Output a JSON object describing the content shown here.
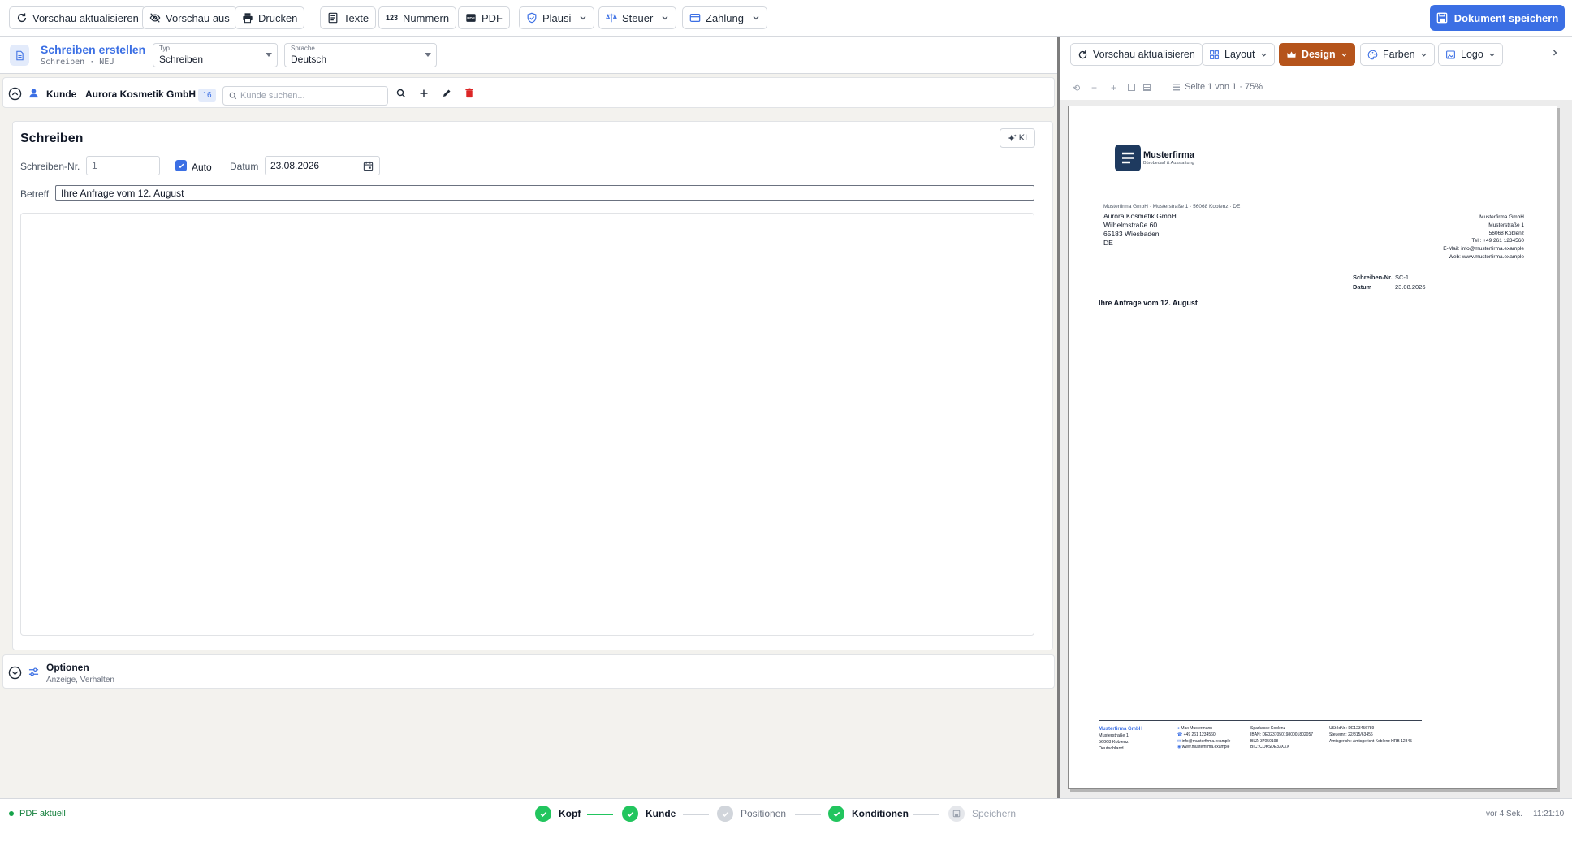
{
  "toolbar": {
    "refresh_preview": "Vorschau aktualisieren",
    "preview_off": "Vorschau aus",
    "print": "Drucken",
    "texts": "Texte",
    "numbers": "Nummern",
    "pdf": "PDF",
    "plausi": "Plausi",
    "tax": "Steuer",
    "payment": "Zahlung",
    "save_document": "Dokument speichern"
  },
  "doc_header": {
    "title": "Schreiben erstellen",
    "subtitle": "Schreiben · NEU",
    "type_label": "Typ",
    "type_value": "Schreiben",
    "language_label": "Sprache",
    "language_value": "Deutsch"
  },
  "customer": {
    "label": "Kunde",
    "name": "Aurora Kosmetik GmbH",
    "count": "16",
    "search_placeholder": "Kunde suchen..."
  },
  "letter": {
    "heading": "Schreiben",
    "ai_label": "KI",
    "number_label": "Schreiben-Nr.",
    "number_value": "1",
    "auto_label": "Auto",
    "date_label": "Datum",
    "date_value": "23.08.2026",
    "subject_label": "Betreff",
    "subject_value": "Ihre Anfrage vom 12. August"
  },
  "options": {
    "title": "Optionen",
    "subtitle": "Anzeige, Verhalten"
  },
  "preview": {
    "refresh": "Vorschau aktualisieren",
    "layout": "Layout",
    "design": "Design",
    "colors": "Farben",
    "logo": "Logo",
    "page_info": "Seite 1 von 1 · 75%",
    "accent_color": "#b5541b"
  },
  "pdf": {
    "company": "Musterfirma",
    "tagline": "Bürobedarf & Ausstattung",
    "sender_line": "Musterfirma GmbH · Musterstraße 1 · 56068 Koblenz · DE",
    "recipient": [
      "Aurora Kosmetik GmbH",
      "Wilhelmstraße 60",
      "65183 Wiesbaden",
      "DE"
    ],
    "sender_block": [
      "Musterfirma GmbH",
      "Musterstraße 1",
      "56068 Koblenz",
      "Tel.: +49 261 1234560",
      "E-Mail: info@musterfirma.example",
      "Web: www.musterfirma.example"
    ],
    "meta_number_label": "Schreiben-Nr.",
    "meta_number_value": "SC-1",
    "meta_date_label": "Datum",
    "meta_date_value": "23.08.2026",
    "subject": "Ihre Anfrage vom 12. August",
    "footer_col1": [
      "Musterfirma GmbH",
      "Musterstraße 1",
      "56068 Koblenz",
      "Deutschland"
    ],
    "footer_col2": [
      "Max Mustermann",
      "+49 261 1234560",
      "info@musterfirma.example",
      "www.musterfirma.example"
    ],
    "footer_col3": [
      "Sparkasse Koblenz",
      "IBAN: DE02370501980001802057",
      "BLZ: 37050198",
      "BIC: COKSDE33XXX"
    ],
    "footer_col4": [
      "USt-IdNr.: DE123456789",
      "Steuernr.: 22/815/63456",
      "Amtsgericht: Amtsgericht Koblenz HRB 12345"
    ]
  },
  "status": {
    "pdf_state": "PDF aktuell",
    "steps": [
      "Kopf",
      "Kunde",
      "Positionen",
      "Konditionen",
      "Speichern"
    ],
    "last_saved": "vor 4 Sek.",
    "time": "11:21:10"
  }
}
